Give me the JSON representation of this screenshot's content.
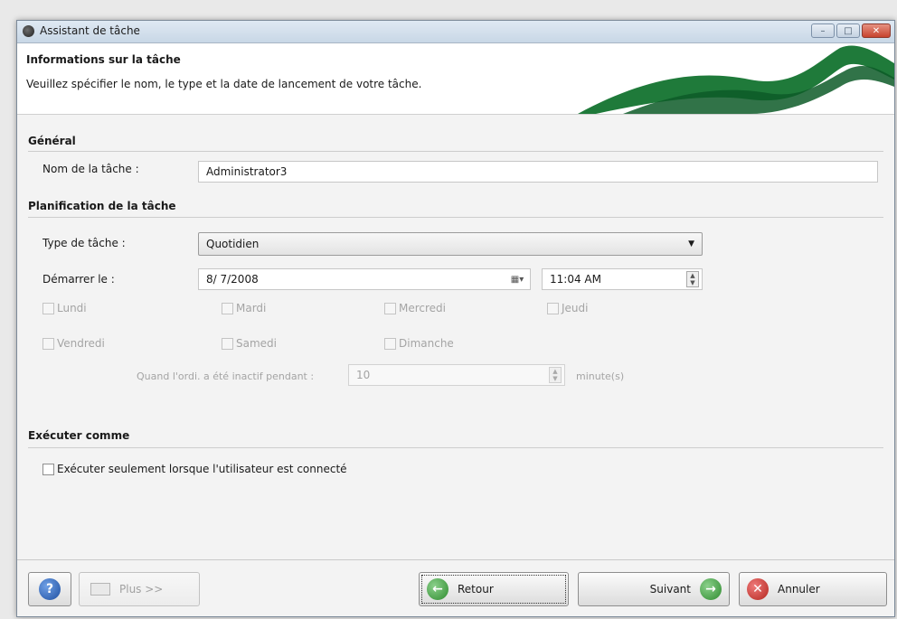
{
  "window": {
    "title": "Assistant de tâche",
    "controls": {
      "minimize": "–",
      "maximize": "□",
      "close": "✕"
    }
  },
  "header": {
    "title": "Informations sur la tâche",
    "subtitle": "Veuillez spécifier le nom, le type et la date de lancement de votre tâche."
  },
  "general": {
    "section": "Général",
    "name_label": "Nom de la tâche :",
    "name_value": "Administrator3"
  },
  "schedule": {
    "section": "Planification de la tâche",
    "type_label": "Type de tâche :",
    "type_value": "Quotidien",
    "start_label": "Démarrer le :",
    "date_value": "8/ 7/2008",
    "time_value": "11:04 AM",
    "days": [
      "Lundi",
      "Mardi",
      "Mercredi",
      "Jeudi",
      "Vendredi",
      "Samedi",
      "Dimanche"
    ],
    "idle_label": "Quand l'ordi. a été inactif pendant :",
    "idle_value": "10",
    "idle_unit": "minute(s)"
  },
  "run_as": {
    "section": "Exécuter comme",
    "only_logged_in": "Exécuter seulement lorsque l'utilisateur est connecté"
  },
  "footer": {
    "help_icon": "help-icon",
    "more_label": "Plus >>",
    "back_label": "Retour",
    "next_label": "Suivant",
    "cancel_label": "Annuler"
  },
  "colors": {
    "accent_green": "#2e8b3e",
    "back_icon": "#3a9a3a",
    "next_icon": "#3a9a3a",
    "cancel_icon": "#c62828",
    "help_icon": "#2a63b8"
  }
}
